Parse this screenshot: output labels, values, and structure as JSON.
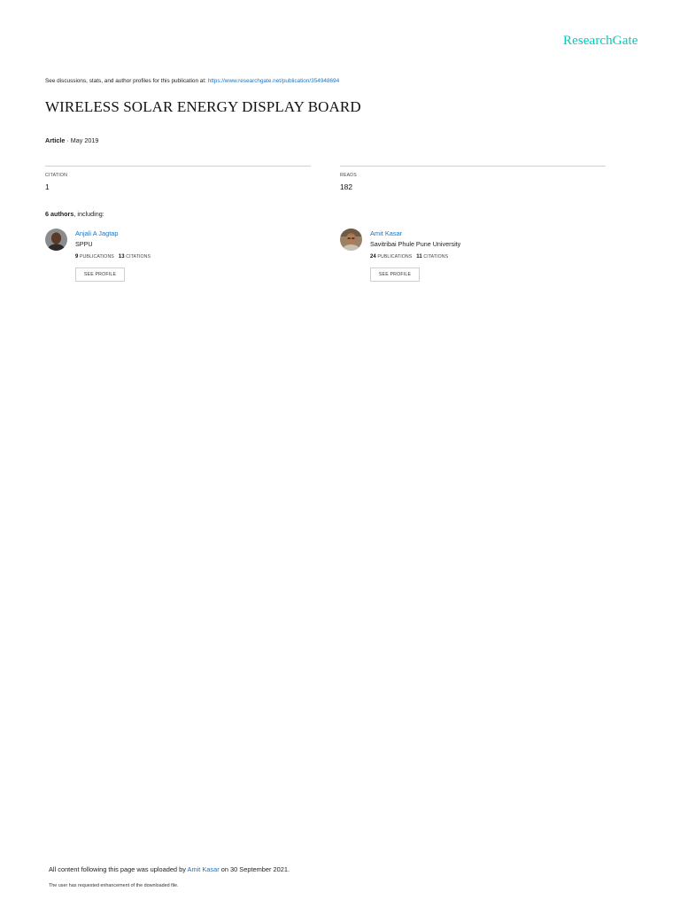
{
  "brand": "ResearchGate",
  "discussion": {
    "prefix": "See discussions, stats, and author profiles for this publication at: ",
    "link": "https://www.researchgate.net/publication/354948694"
  },
  "title": "WIRELESS SOLAR ENERGY DISPLAY BOARD",
  "article": {
    "type": "Article",
    "date": " · May 2019"
  },
  "stats": {
    "citation_label": "CITATION",
    "citation_value": "1",
    "reads_label": "READS",
    "reads_value": "182"
  },
  "authors_line": {
    "count": "6 authors",
    "suffix": ", including:"
  },
  "authors": [
    {
      "name": "Anjali A Jagtap",
      "institution": "SPPU",
      "publications": "9",
      "publications_label": "PUBLICATIONS",
      "citations": "13",
      "citations_label": "CITATIONS",
      "button": "SEE PROFILE"
    },
    {
      "name": "Amit Kasar",
      "institution": "Savitribai Phule Pune University",
      "publications": "24",
      "publications_label": "PUBLICATIONS",
      "citations": "11",
      "citations_label": "CITATIONS",
      "button": "SEE PROFILE"
    }
  ],
  "footer": {
    "upload_prefix": "All content following this page was uploaded by ",
    "uploader": "Amit Kasar",
    "upload_suffix": " on 30 September 2021.",
    "note": "The user has requested enhancement of the downloaded file."
  }
}
